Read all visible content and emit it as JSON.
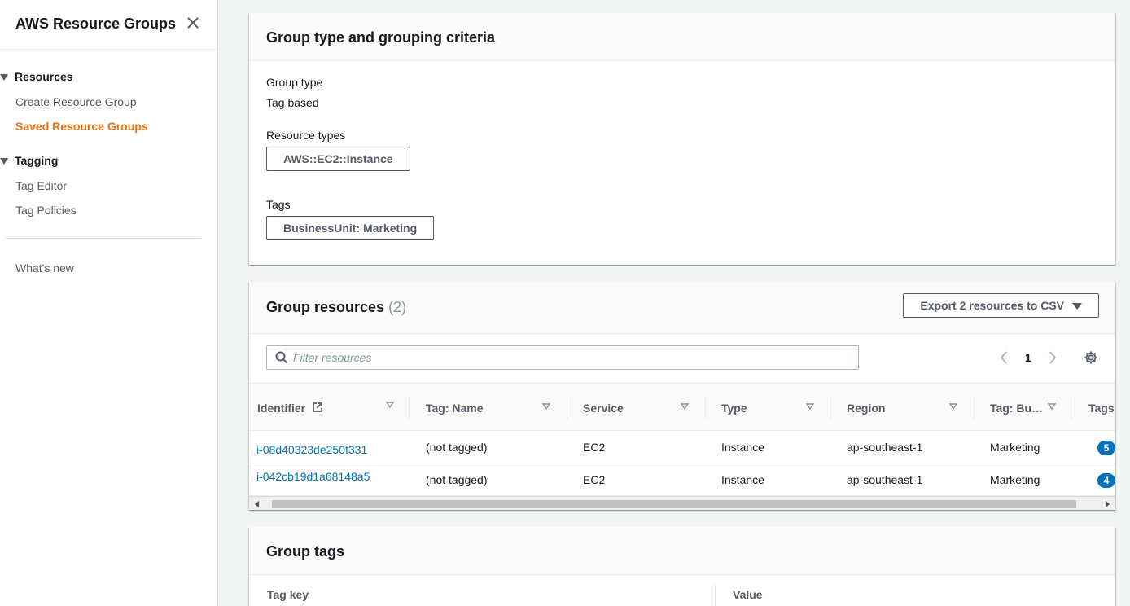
{
  "sidebar": {
    "title": "AWS Resource Groups",
    "sections": [
      {
        "label": "Resources",
        "items": [
          {
            "label": "Create Resource Group"
          },
          {
            "label": "Saved Resource Groups"
          }
        ]
      },
      {
        "label": "Tagging",
        "items": [
          {
            "label": "Tag Editor"
          },
          {
            "label": "Tag Policies"
          }
        ]
      }
    ],
    "whats_new": "What's new"
  },
  "criteria": {
    "title": "Group type and grouping criteria",
    "group_type_label": "Group type",
    "group_type_value": "Tag based",
    "resource_types_label": "Resource types",
    "resource_types": [
      "AWS::EC2::Instance"
    ],
    "tags_label": "Tags",
    "tags": [
      "BusinessUnit: Marketing"
    ]
  },
  "resources": {
    "title": "Group resources",
    "count": "(2)",
    "export_label": "Export 2 resources to CSV",
    "filter_placeholder": "Filter resources",
    "page": "1",
    "columns": [
      "Identifier",
      "Tag: Name",
      "Service",
      "Type",
      "Region",
      "Tag: Bu…",
      "Tags"
    ],
    "rows": [
      {
        "identifier": "i-08d40323de250f331",
        "name": "(not tagged)",
        "service": "EC2",
        "type": "Instance",
        "region": "ap-southeast-1",
        "bu": "Marketing",
        "tags": "5"
      },
      {
        "identifier": "i-042cb19d1a68148a5",
        "name": "(not tagged)",
        "service": "EC2",
        "type": "Instance",
        "region": "ap-southeast-1",
        "bu": "Marketing",
        "tags": "4"
      }
    ]
  },
  "group_tags": {
    "title": "Group tags",
    "col_key": "Tag key",
    "col_value": "Value"
  },
  "colors": {
    "accent": "#ec7211",
    "link": "#0073bb",
    "badge": "#0073bb"
  }
}
